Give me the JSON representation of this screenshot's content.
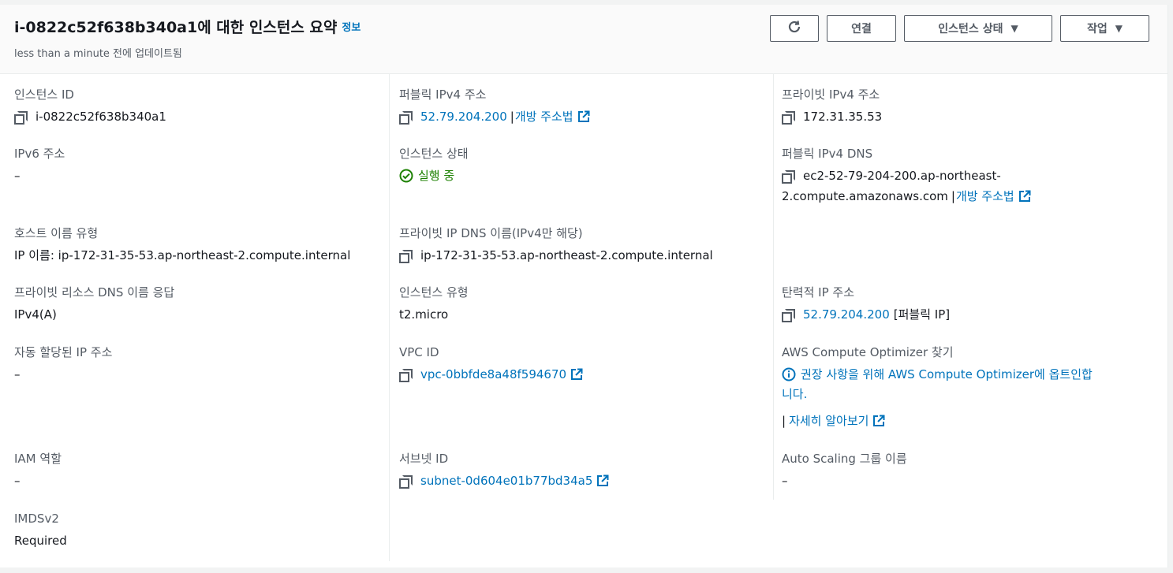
{
  "header": {
    "title": "i-0822c52f638b340a1에 대한 인스턴스 요약",
    "info_link": "정보",
    "subtitle": "less than a minute 전에 업데이트됨",
    "connect_label": "연결",
    "instance_state_label": "인스턴스 상태",
    "actions_label": "작업"
  },
  "col1": {
    "instance_id_label": "인스턴스 ID",
    "instance_id_value": "i-0822c52f638b340a1",
    "ipv6_label": "IPv6 주소",
    "ipv6_value": "–",
    "hostname_type_label": "호스트 이름 유형",
    "hostname_type_value": "IP 이름: ip-172-31-35-53.ap-northeast-2.compute.internal",
    "private_dns_answer_label": "프라이빗 리소스 DNS 이름 응답",
    "private_dns_answer_value": "IPv4(A)",
    "auto_ip_label": "자동 할당된 IP 주소",
    "auto_ip_value": "–",
    "iam_label": "IAM 역할",
    "iam_value": "–",
    "imds_label": "IMDSv2",
    "imds_value": "Required"
  },
  "col2": {
    "public_ipv4_label": "퍼블릭 IPv4 주소",
    "public_ipv4_value": "52.79.204.200",
    "open_address_link": "개방 주소법",
    "instance_state_label": "인스턴스 상태",
    "instance_state_value": "실행 중",
    "private_ip_dns_label": "프라이빗 IP DNS 이름(IPv4만 해당)",
    "private_ip_dns_value": "ip-172-31-35-53.ap-northeast-2.compute.internal",
    "instance_type_label": "인스턴스 유형",
    "instance_type_value": "t2.micro",
    "vpc_label": "VPC ID",
    "vpc_value": "vpc-0bbfde8a48f594670",
    "subnet_label": "서브넷 ID",
    "subnet_value": "subnet-0d604e01b77bd34a5"
  },
  "col3": {
    "private_ipv4_label": "프라이빗 IPv4 주소",
    "private_ipv4_value": "172.31.35.53",
    "public_dns_label": "퍼블릭 IPv4 DNS",
    "public_dns_line1": "ec2-52-79-204-200.ap-northeast-",
    "public_dns_line2": "2.compute.amazonaws.com",
    "open_address_link": "개방 주소법",
    "elastic_ip_label": "탄력적 IP 주소",
    "elastic_ip_value": "52.79.204.200",
    "elastic_ip_suffix": "[퍼블릭 IP]",
    "optimizer_label": "AWS Compute Optimizer 찾기",
    "optimizer_link_line1": "권장 사항을 위해 AWS Compute Optimizer에 옵트인합",
    "optimizer_link_line2": "니다.",
    "learn_more_link": "자세히 알아보기",
    "autoscaling_label": "Auto Scaling 그룹 이름",
    "autoscaling_value": "–"
  },
  "colors": {
    "link": "#0073bb",
    "success": "#1d8102",
    "label": "#545b64"
  },
  "icons": [
    "refresh-icon",
    "caret-down-icon",
    "copy-icon",
    "external-link-icon",
    "check-circle-icon",
    "info-circle-icon"
  ]
}
